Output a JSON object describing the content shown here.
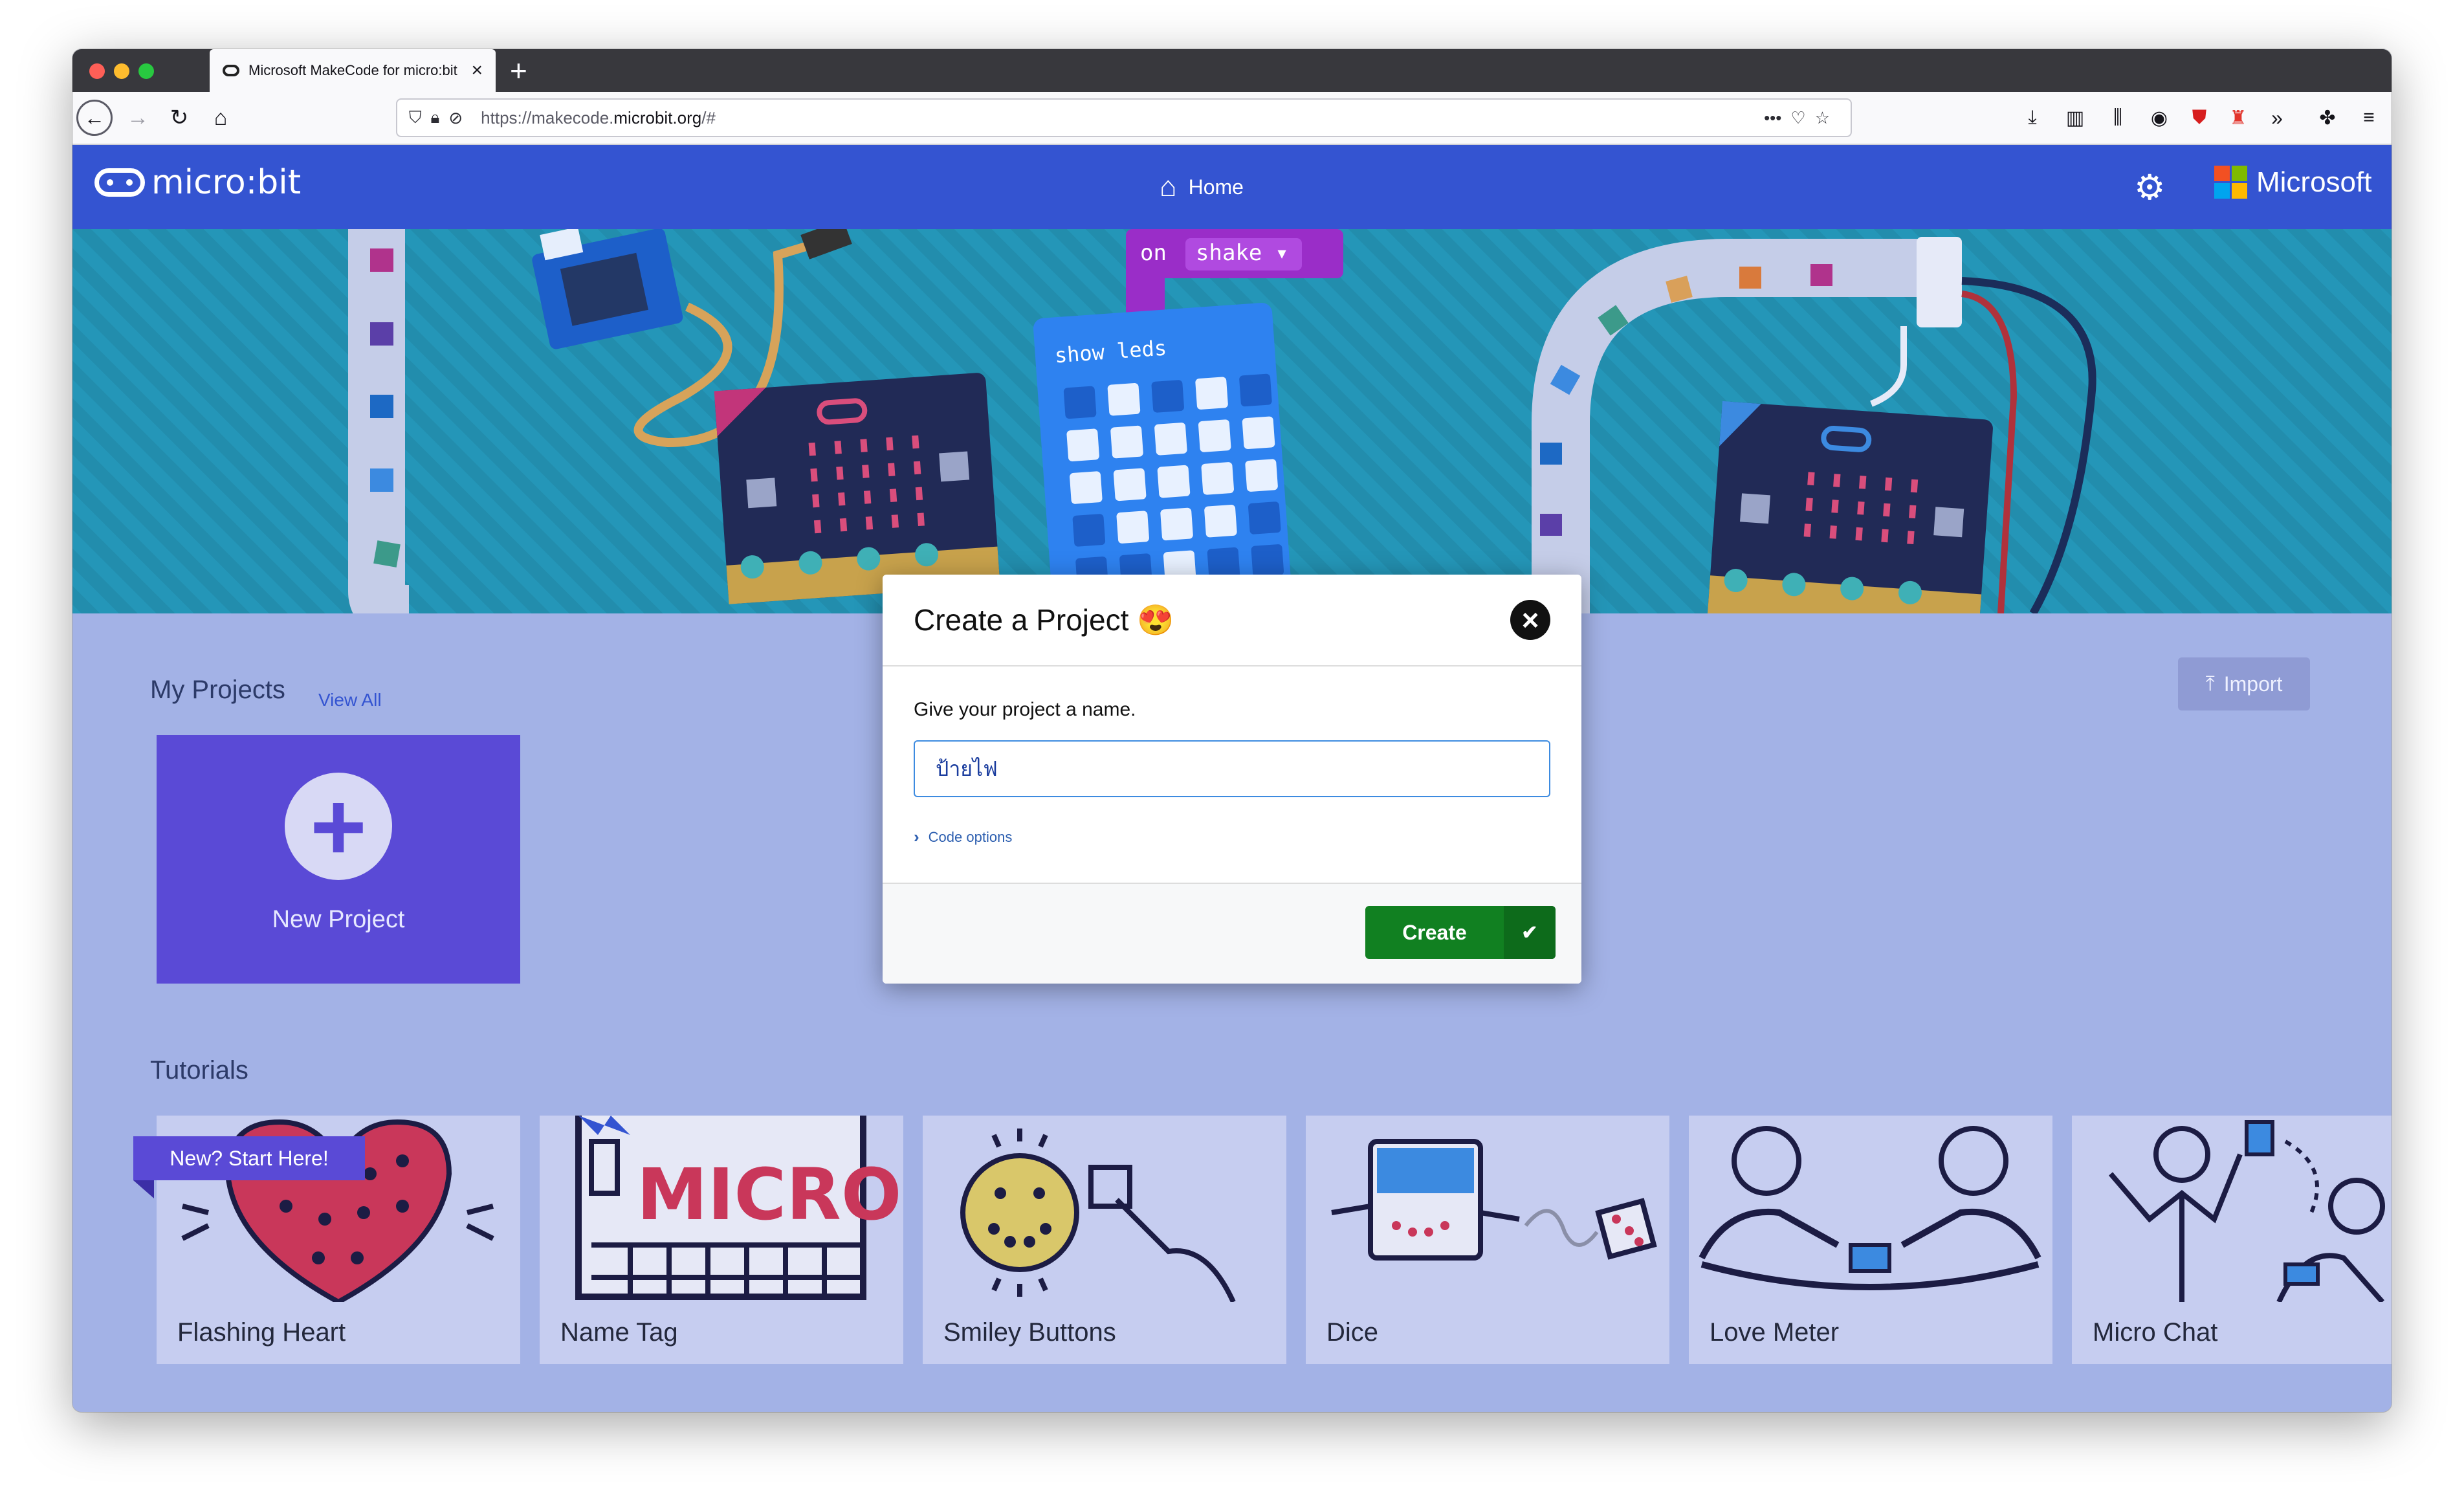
{
  "browser": {
    "tab_title": "Microsoft MakeCode for micro:bit",
    "url_prefix": "https://makecode.",
    "url_domain": "microbit.org",
    "url_suffix": "/#"
  },
  "navbar": {
    "brand": "micro:bit",
    "home": "Home",
    "microsoft": "Microsoft"
  },
  "hero": {
    "block_on": "on",
    "block_shake": "shake ▾",
    "block_show_leds": "show leds"
  },
  "my_projects": {
    "title": "My Projects",
    "view_all": "View All",
    "new_project": "New Project",
    "import": "Import"
  },
  "tutorials": {
    "title": "Tutorials",
    "ribbon": "New? Start Here!",
    "items": [
      {
        "label": "Flashing Heart"
      },
      {
        "label": "Name Tag"
      },
      {
        "label": "Smiley Buttons"
      },
      {
        "label": "Dice"
      },
      {
        "label": "Love Meter"
      },
      {
        "label": "Micro Chat"
      }
    ],
    "name_tag_art": "MICRO"
  },
  "modal": {
    "title": "Create a Project 😍",
    "prompt": "Give your project a name.",
    "input_value": "ป้ายไฟ",
    "code_options": "Code options",
    "create": "Create"
  },
  "colors": {
    "navbar": "#3454d1",
    "page_bg": "#a3b2e6",
    "new_project": "#5a4ad6",
    "create_button": "#118021"
  }
}
